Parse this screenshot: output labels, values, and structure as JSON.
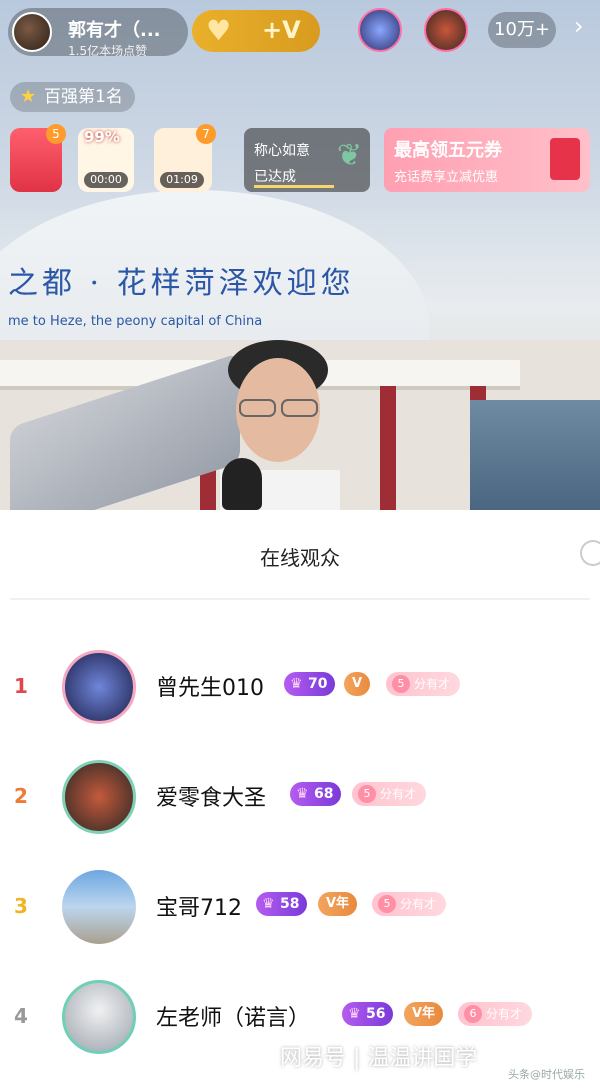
{
  "topbar": {
    "host_name": "郭有才（...",
    "host_likes": "1.5亿本场点赞",
    "follow_plus": "+V",
    "viewer_count": "10万+",
    "close_icon": "close-icon"
  },
  "badges": {
    "rank": "百强第1名"
  },
  "gifts": [
    {
      "count": "5",
      "label": ""
    },
    {
      "percent": "99%",
      "timer": "00:00"
    },
    {
      "count": "7",
      "timer": "01:09"
    }
  ],
  "wish": {
    "line1": "称心如意",
    "line2": "已达成"
  },
  "coupon": {
    "title": "最高领五元券",
    "subtitle": "充话费享立减优惠"
  },
  "stream": {
    "sign_cn": "之都 · 花样菏泽欢迎您",
    "sign_en": "me to Heze, the peony capital of China"
  },
  "audience": {
    "title": "在线观众",
    "rows": [
      {
        "rank": "1",
        "name": "曾先生010",
        "level": "70",
        "vip": "V",
        "fan_level": "5",
        "fan_club": "分有才"
      },
      {
        "rank": "2",
        "name": "爱零食大圣",
        "level": "68",
        "vip": "",
        "fan_level": "5",
        "fan_club": "分有才"
      },
      {
        "rank": "3",
        "name": "宝哥712",
        "level": "58",
        "vip": "V年",
        "fan_level": "5",
        "fan_club": "分有才"
      },
      {
        "rank": "4",
        "name": "左老师（诺言）",
        "level": "56",
        "vip": "V年",
        "fan_level": "6",
        "fan_club": "分有才"
      }
    ]
  },
  "watermark": {
    "main": "网易号 | 温温讲国学",
    "sub": "头条@时代娱乐"
  },
  "colors": {
    "rank1": "#e0474c",
    "rank2": "#ef7a33",
    "rank3": "#f0b429",
    "rank4": "#999999",
    "accent": "#b45cf0"
  }
}
